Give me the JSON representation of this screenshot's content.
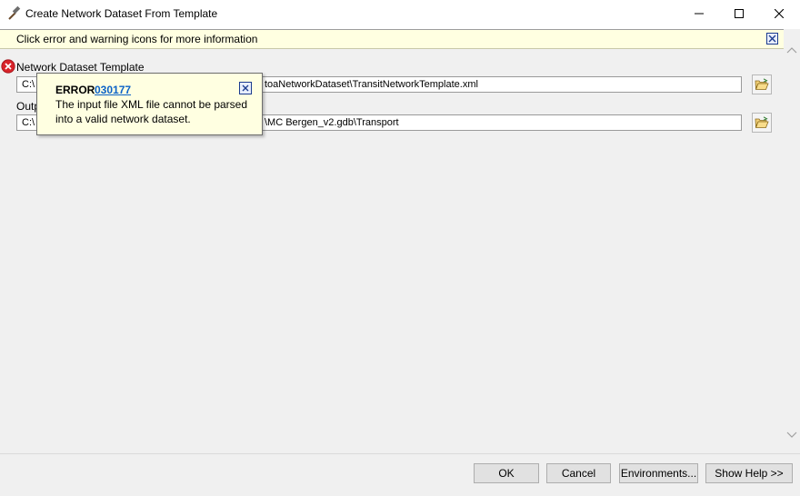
{
  "window": {
    "title": "Create Network Dataset From Template"
  },
  "infobar": {
    "message": "Click error and warning icons for more information"
  },
  "params": {
    "template": {
      "label": "Network Dataset Template",
      "value_prefix": "C:\\",
      "value_suffix": "toaNetworkDataset\\TransitNetworkTemplate.xml"
    },
    "output": {
      "label": "Outp",
      "value_prefix": "C:\\",
      "value_suffix": "\\MC Bergen_v2.gdb\\Transport"
    }
  },
  "tooltip": {
    "title": "ERROR",
    "code": "030177",
    "line1": "The input file XML file cannot be parsed",
    "line2": "into a valid network dataset."
  },
  "footer": {
    "ok": "OK",
    "cancel": "Cancel",
    "environments": "Environments...",
    "show_help": "Show Help >>"
  },
  "icons": {
    "app": "hammer-icon",
    "error": "error-icon",
    "browse": "folder-open-icon",
    "close": "close-icon"
  },
  "colors": {
    "infobar_bg": "#ffffe1",
    "error_red": "#d8232a",
    "link_blue": "#0b62c7"
  }
}
